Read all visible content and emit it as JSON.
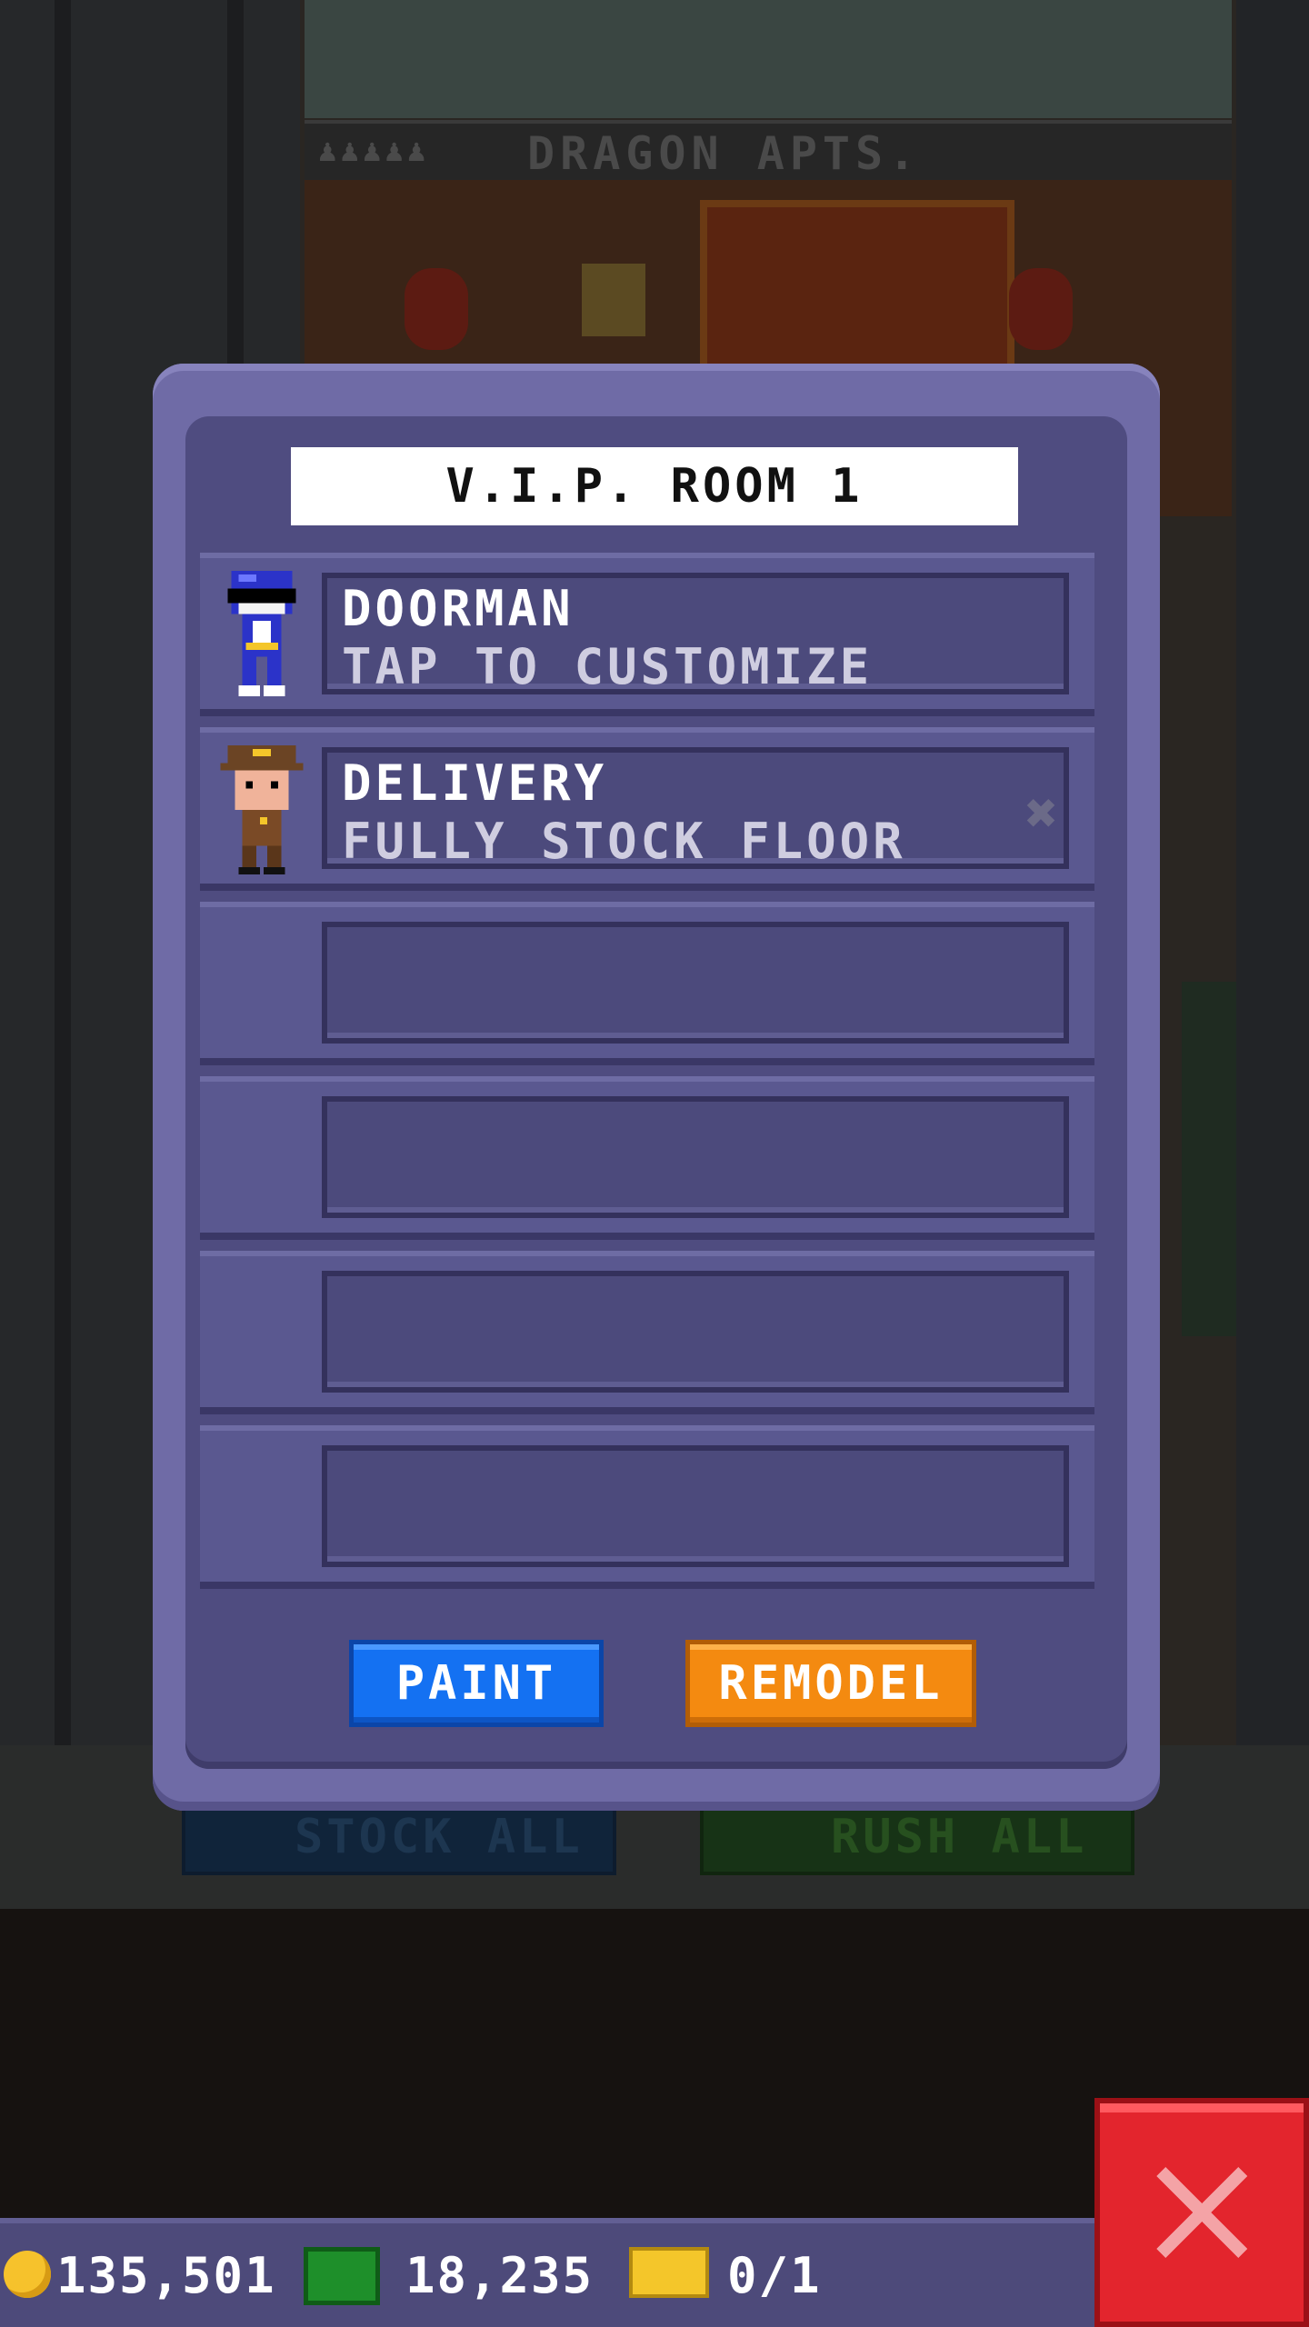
{
  "background": {
    "building_sign": "DRAGON APTS.",
    "stock_all_label": "STOCK ALL",
    "rush_all_label": "RUSH ALL"
  },
  "dialog": {
    "title": "V.I.P. ROOM 1",
    "rows": [
      {
        "name": "DOORMAN",
        "status": "TAP TO CUSTOMIZE",
        "avatar": "blue-ranger-bitizen"
      },
      {
        "name": "DELIVERY",
        "status": "FULLY STOCK FLOOR",
        "avatar": "delivery-man-bitizen",
        "dismiss_icon": "x-mark-icon"
      },
      {
        "name": "",
        "status": ""
      },
      {
        "name": "",
        "status": ""
      },
      {
        "name": "",
        "status": ""
      },
      {
        "name": "",
        "status": ""
      }
    ],
    "buttons": {
      "paint": "PAINT",
      "remodel": "REMODEL"
    }
  },
  "bottom_bar": {
    "coins": "135,501",
    "bux": "18,235",
    "tickets": "0/1",
    "close_icon": "close-x-icon"
  },
  "colors": {
    "dialog_frame": "#6f6ba6",
    "dialog_inner": "#4f4c80",
    "paint_button": "#1471f2",
    "remodel_button": "#f48a10",
    "close_button": "#e3252d"
  }
}
